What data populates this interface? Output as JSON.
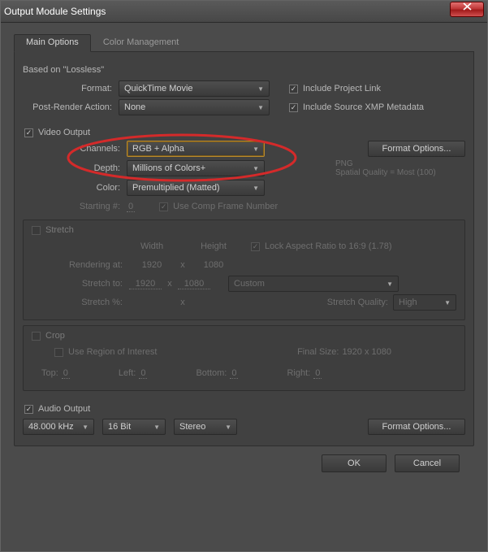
{
  "window": {
    "title": "Output Module Settings"
  },
  "tabs": {
    "main": "Main Options",
    "color": "Color Management"
  },
  "top": {
    "based_on": "Based on \"Lossless\"",
    "format_label": "Format:",
    "format_value": "QuickTime Movie",
    "include_link": "Include Project Link",
    "post_render_label": "Post-Render Action:",
    "post_render_value": "None",
    "include_xmp": "Include Source XMP Metadata"
  },
  "video": {
    "header": "Video Output",
    "channels_label": "Channels:",
    "channels_value": "RGB + Alpha",
    "format_options_btn": "Format Options...",
    "depth_label": "Depth:",
    "depth_value": "Millions of Colors+",
    "codec_line1": "PNG",
    "codec_line2": "Spatial Quality = Most (100)",
    "color_label": "Color:",
    "color_value": "Premultiplied (Matted)",
    "starting_label": "Starting #:",
    "starting_value": "0",
    "use_comp": "Use Comp Frame Number"
  },
  "stretch": {
    "header": "Stretch",
    "width_h": "Width",
    "height_h": "Height",
    "lock": "Lock Aspect Ratio to 16:9 (1.78)",
    "rendering_label": "Rendering at:",
    "rendering_w": "1920",
    "rendering_h": "1080",
    "stretch_to_label": "Stretch to:",
    "stretch_to_w": "1920",
    "stretch_to_h": "1080",
    "custom": "Custom",
    "stretch_pct_label": "Stretch %:",
    "stretch_q_label": "Stretch Quality:",
    "stretch_q_value": "High",
    "x": "x"
  },
  "crop": {
    "header": "Crop",
    "roi": "Use Region of Interest",
    "final_size_label": "Final Size:",
    "final_size_value": "1920 x 1080",
    "top_l": "Top:",
    "top_v": "0",
    "left_l": "Left:",
    "left_v": "0",
    "bottom_l": "Bottom:",
    "bottom_v": "0",
    "right_l": "Right:",
    "right_v": "0"
  },
  "audio": {
    "header": "Audio Output",
    "rate": "48.000 kHz",
    "bit": "16 Bit",
    "channels": "Stereo",
    "format_options_btn": "Format Options..."
  },
  "footer": {
    "ok": "OK",
    "cancel": "Cancel"
  }
}
